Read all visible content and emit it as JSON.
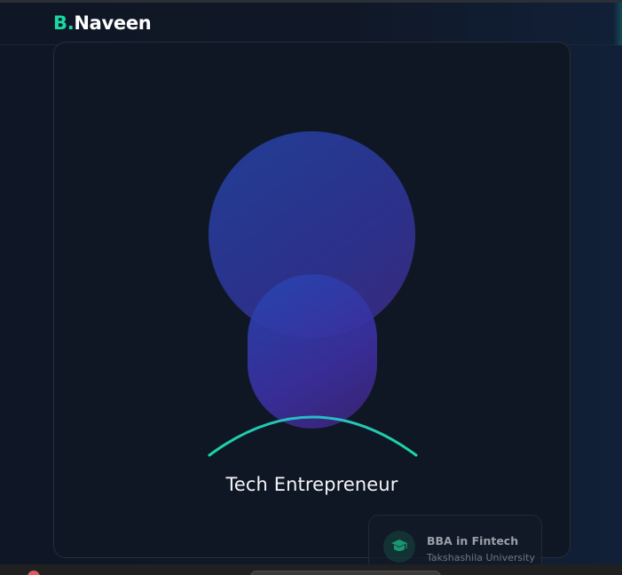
{
  "brand": {
    "accent": "B.",
    "name": "Naveen"
  },
  "hero": {
    "role": "Tech Entrepreneur"
  },
  "education": {
    "degree": "BBA in Fintech",
    "institution": "Takshashila University",
    "icon": "graduation-cap-icon"
  },
  "colors": {
    "accent": "#19d8a0",
    "background": "#101827",
    "avatar_start": "#23409a",
    "avatar_end": "#3a2a80"
  }
}
